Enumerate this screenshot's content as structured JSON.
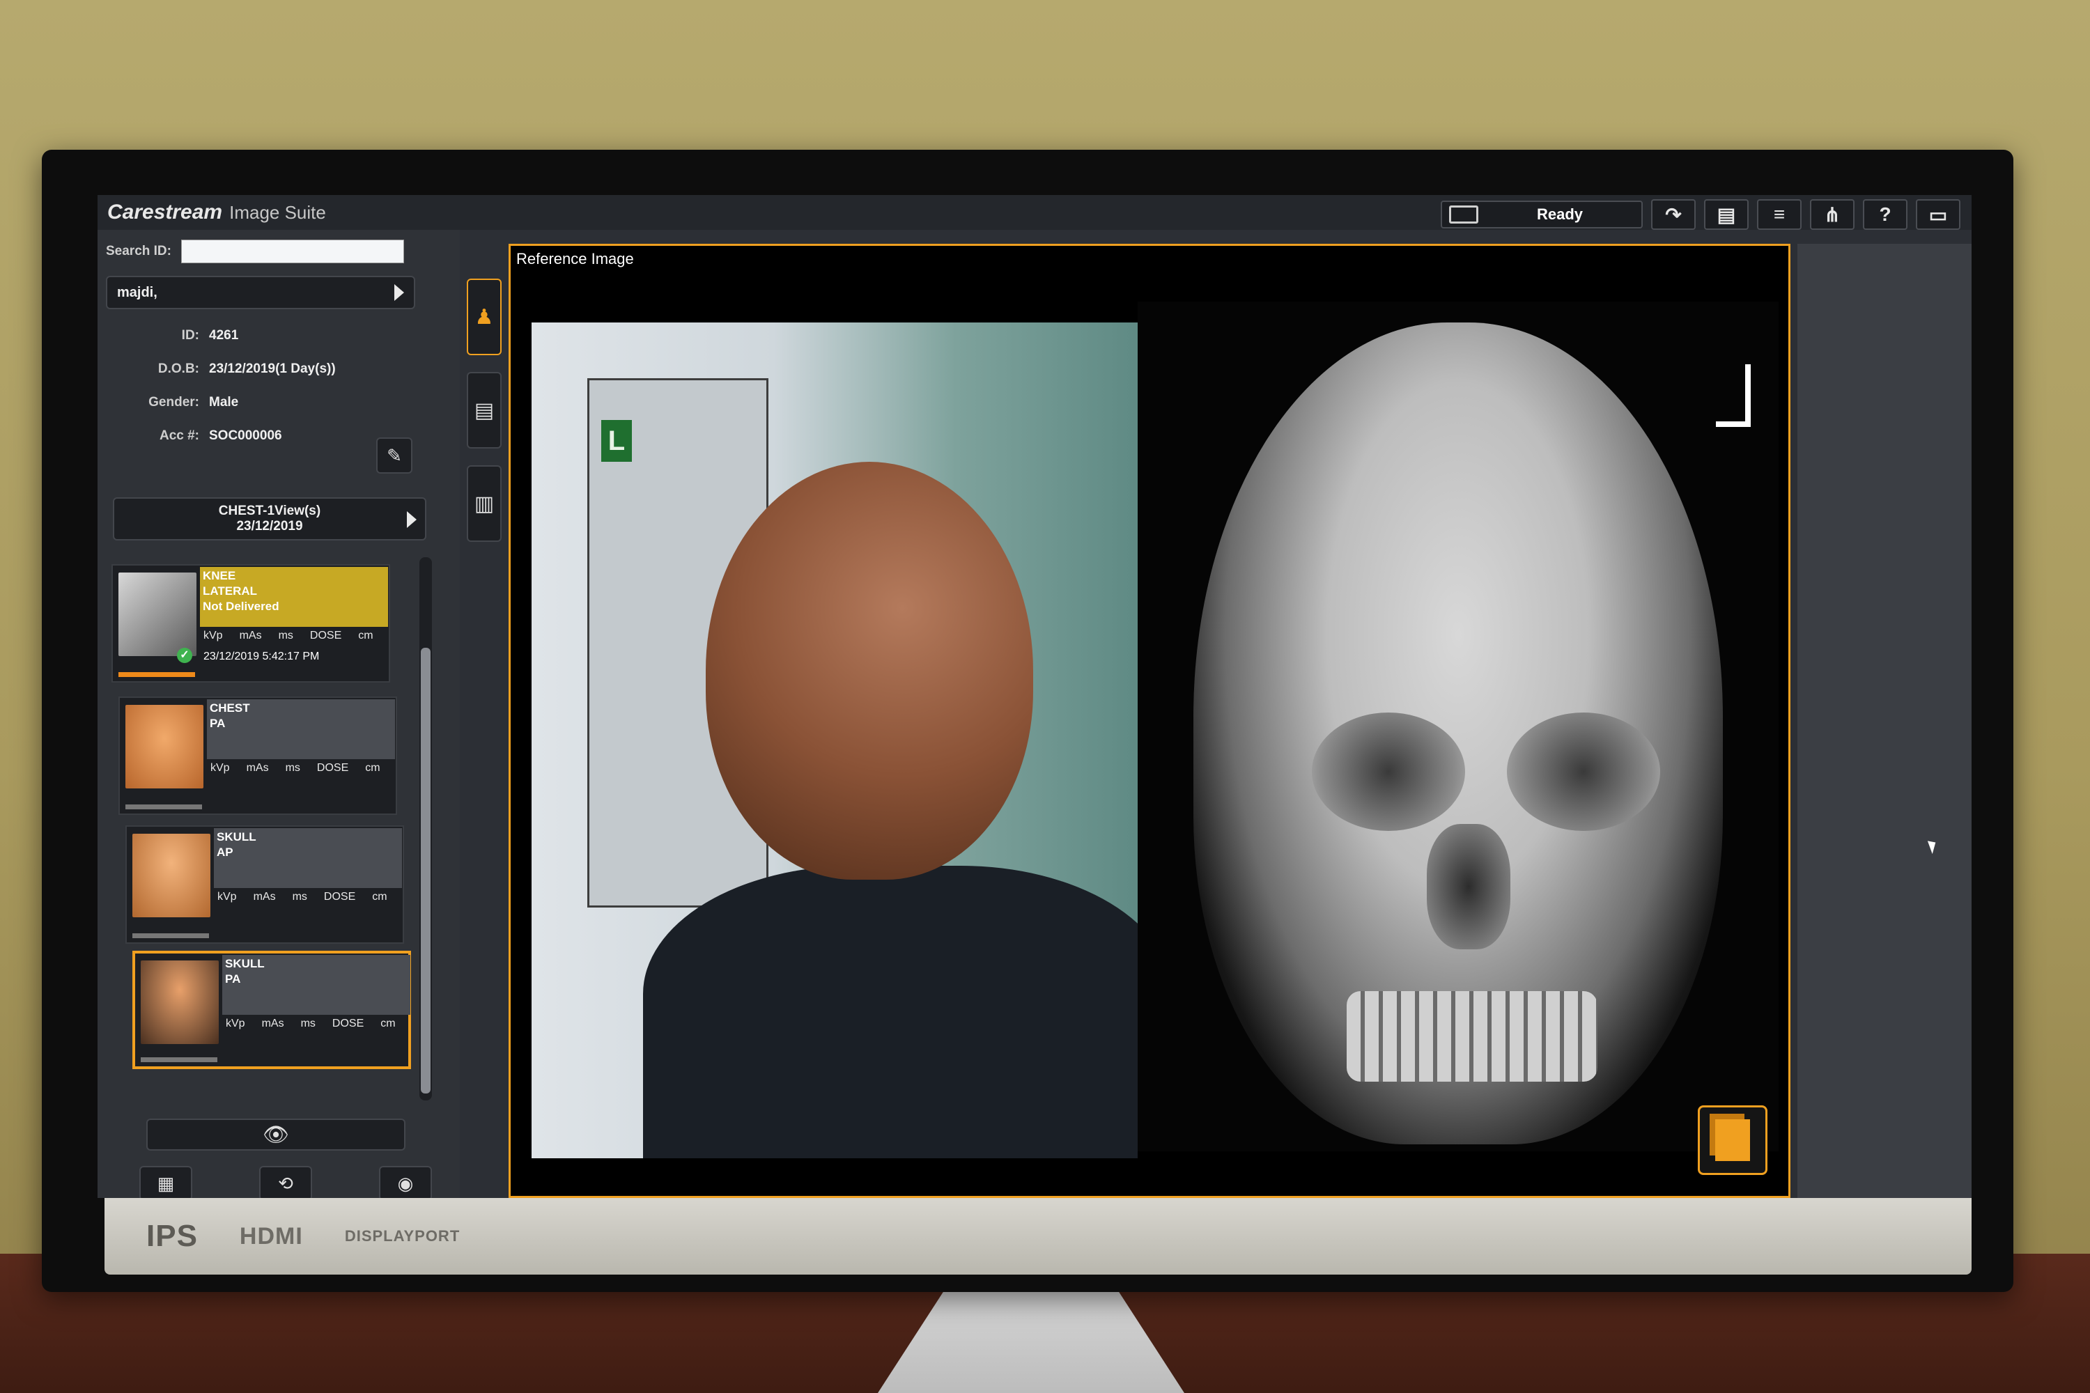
{
  "app": {
    "brand": "Carestream",
    "product": "Image Suite",
    "status": "Ready"
  },
  "toolbar": {
    "buttons": [
      "redo-icon",
      "print-icon",
      "database-icon",
      "network-icon",
      "help-icon",
      "folder-icon"
    ],
    "help_label": "?"
  },
  "search": {
    "label": "Search ID:",
    "value": ""
  },
  "patient": {
    "name": "majdi,",
    "fields": [
      {
        "key": "ID:",
        "value": "4261"
      },
      {
        "key": "D.O.B:",
        "value": "23/12/2019(1 Day(s))"
      },
      {
        "key": "Gender:",
        "value": "Male"
      },
      {
        "key": "Acc #:",
        "value": "SOC000006"
      }
    ]
  },
  "study": {
    "title": "CHEST-1View(s)",
    "date": "23/12/2019"
  },
  "thumbnails": [
    {
      "line1": "KNEE",
      "line2": "LATERAL",
      "line3": "Not Delivered",
      "params": [
        "kVp",
        "mAs",
        "ms",
        "DOSE",
        "cm"
      ],
      "date": "23/12/2019 5:42:17 PM"
    },
    {
      "line1": "CHEST",
      "line2": "PA",
      "params": [
        "kVp",
        "mAs",
        "ms",
        "DOSE",
        "cm"
      ]
    },
    {
      "line1": "SKULL",
      "line2": "AP",
      "params": [
        "kVp",
        "mAs",
        "ms",
        "DOSE",
        "cm"
      ]
    },
    {
      "line1": "SKULL",
      "line2": "PA",
      "params": [
        "kVp",
        "mAs",
        "ms",
        "DOSE",
        "cm"
      ]
    }
  ],
  "viewer": {
    "title": "Reference Image",
    "marker": "L"
  },
  "monitor": {
    "badges": [
      "IPS",
      "HDMI",
      "DISPLAYPORT"
    ]
  },
  "colors": {
    "accent": "#f0a020",
    "warning": "#c7a924",
    "ok": "#3fb34f"
  }
}
